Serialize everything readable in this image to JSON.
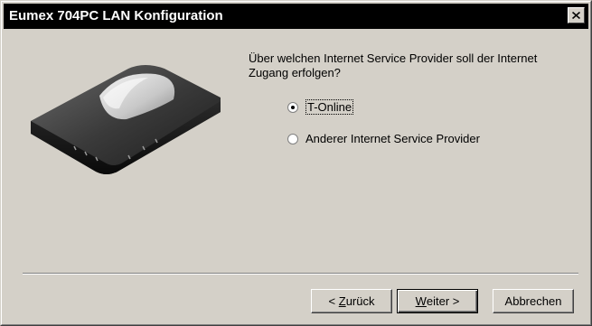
{
  "window": {
    "title": "Eumex 704PC LAN Konfiguration",
    "close_icon": "close-icon"
  },
  "content": {
    "question": "Über welchen Internet Service Provider soll der Internet Zugang erfolgen?",
    "options": [
      {
        "label": "T-Online",
        "selected": true
      },
      {
        "label": "Anderer Internet Service Provider",
        "selected": false
      }
    ]
  },
  "buttons": {
    "back_prefix": "< ",
    "back_mnemonic": "Z",
    "back_rest": "urück",
    "next_mnemonic": "W",
    "next_rest": "eiter >",
    "cancel": "Abbrechen"
  },
  "colors": {
    "titlebar": "#000000",
    "face": "#d4d0c8"
  }
}
